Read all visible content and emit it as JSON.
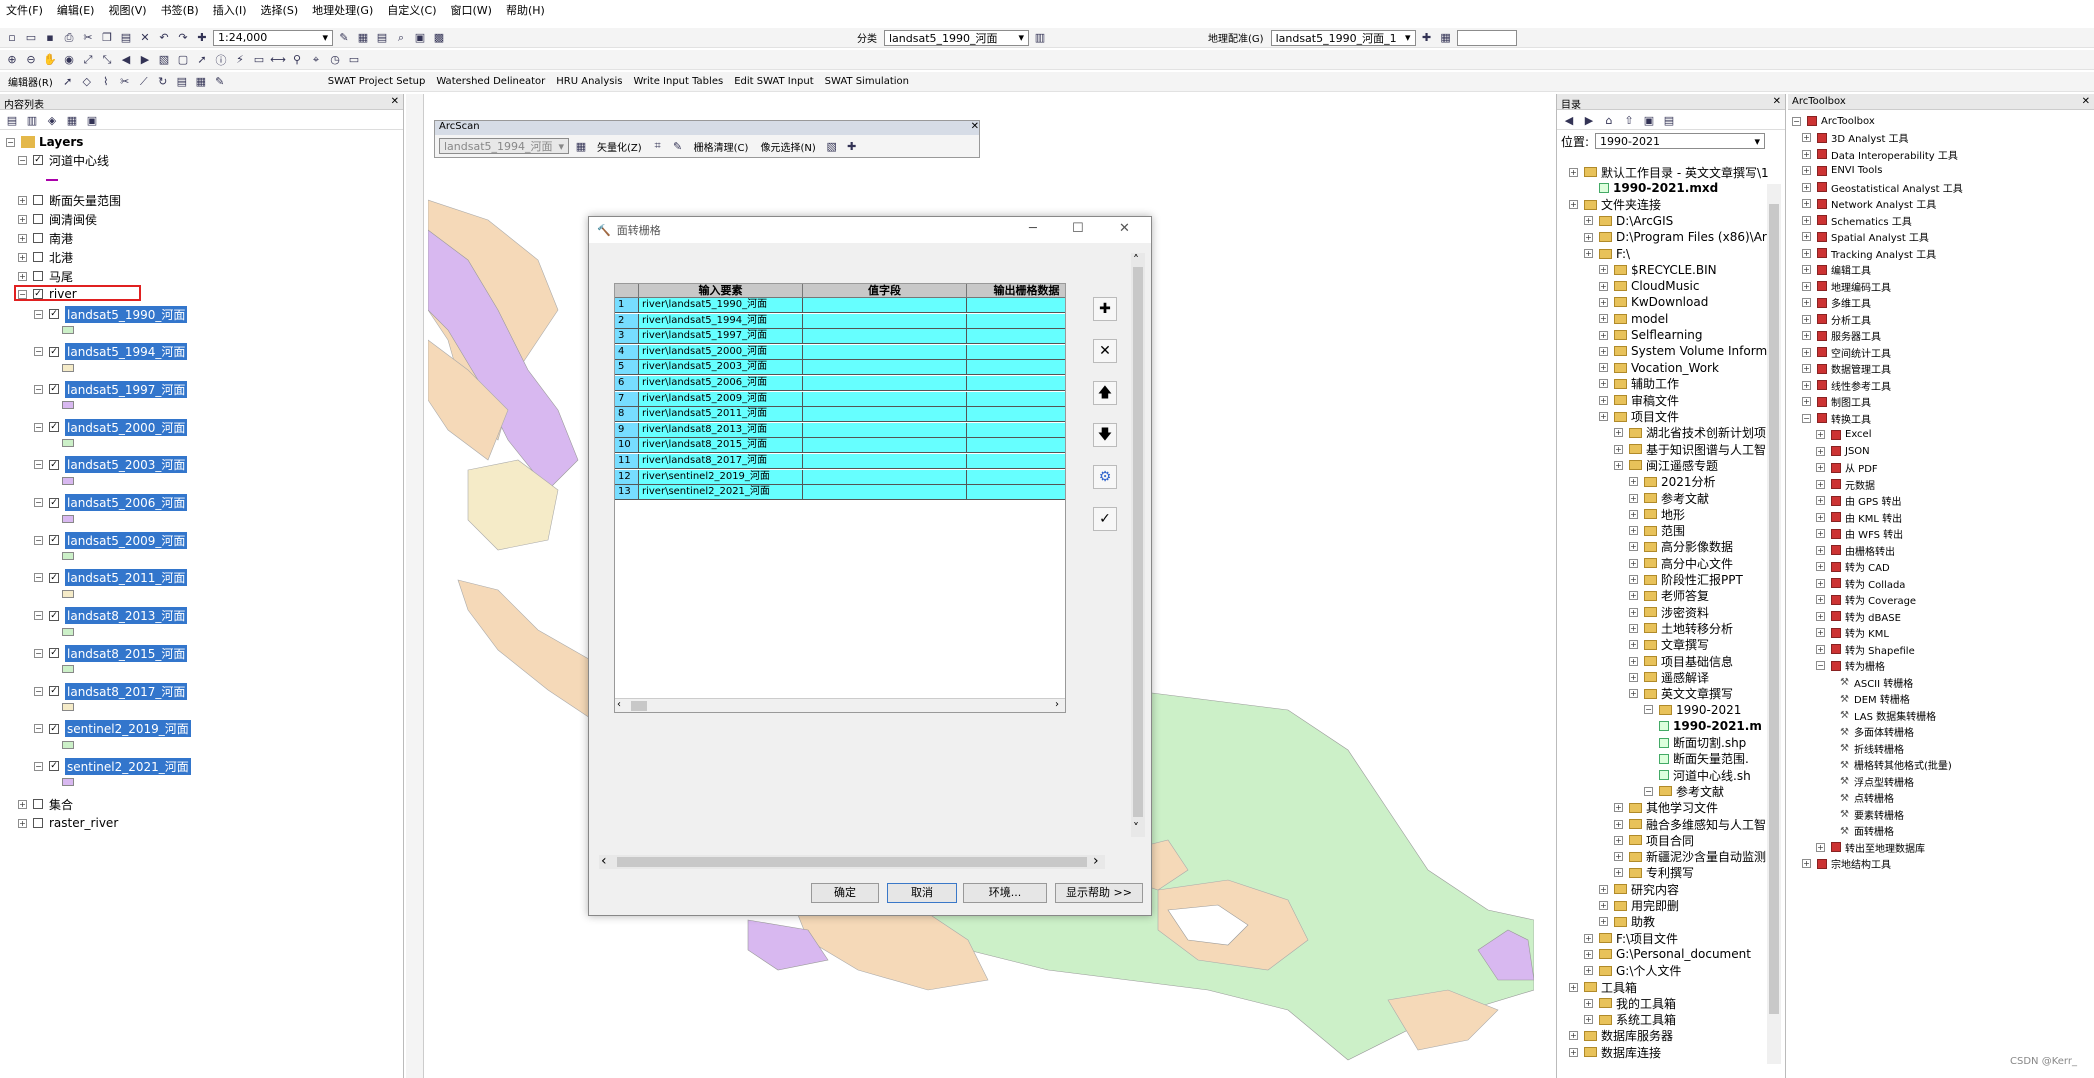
{
  "menu": [
    "文件(F)",
    "编辑(E)",
    "视图(V)",
    "书签(B)",
    "插入(I)",
    "选择(S)",
    "地理处理(G)",
    "自定义(C)",
    "窗口(W)",
    "帮助(H)"
  ],
  "toolbar": {
    "scale": "1:24,000",
    "classify_label": "分类",
    "classify_layer": "landsat5_1990_河面",
    "georef_label": "地理配准(G)",
    "georef_layer": "landsat5_1990_河面_1",
    "editor_label": "编辑器(R)",
    "swat_menus": [
      "SWAT Project Setup",
      "Watershed Delineator",
      "HRU Analysis",
      "Write Input Tables",
      "Edit SWAT Input",
      "SWAT Simulation"
    ]
  },
  "toc": {
    "title": "内容列表",
    "layers_root": "Layers",
    "items": [
      "河道中心线",
      "断面矢量范围",
      "闽清闽侯",
      "南港",
      "北港",
      "马尾",
      "river"
    ],
    "river_children": [
      "landsat5_1990_河面",
      "landsat5_1994_河面",
      "landsat5_1997_河面",
      "landsat5_2000_河面",
      "landsat5_2003_河面",
      "landsat5_2006_河面",
      "landsat5_2009_河面",
      "landsat5_2011_河面",
      "landsat8_2013_河面",
      "landsat8_2015_河面",
      "landsat8_2017_河面",
      "sentinel2_2019_河面",
      "sentinel2_2021_河面"
    ],
    "bottom_items": [
      "集合",
      "raster_river"
    ]
  },
  "arcscan": {
    "title": "ArcScan",
    "layer": "landsat5_1994_河面",
    "vectorize": "矢量化(Z)",
    "cleanup": "栅格清理(C)",
    "select": "像元选择(N)"
  },
  "dialog": {
    "title": "面转栅格",
    "columns": [
      "输入要素",
      "值字段",
      "输出栅格数据"
    ],
    "rows": [
      "river\\landsat5_1990_河面",
      "river\\landsat5_1994_河面",
      "river\\landsat5_1997_河面",
      "river\\landsat5_2000_河面",
      "river\\landsat5_2003_河面",
      "river\\landsat5_2006_河面",
      "river\\landsat5_2009_河面",
      "river\\landsat5_2011_河面",
      "river\\landsat8_2013_河面",
      "river\\landsat8_2015_河面",
      "river\\landsat8_2017_河面",
      "river\\sentinel2_2019_河面",
      "river\\sentinel2_2021_河面"
    ],
    "ok": "确定",
    "cancel": "取消",
    "env": "环境...",
    "help": "显示帮助 >>"
  },
  "catalog": {
    "title": "目录",
    "location_label": "位置:",
    "location_value": "1990-2021",
    "items": [
      "默认工作目录 - 英文文章撰写\\1",
      "1990-2021.mxd",
      "文件夹连接",
      "D:\\ArcGIS",
      "D:\\Program Files (x86)\\Arc",
      "F:\\",
      "$RECYCLE.BIN",
      "CloudMusic",
      "KwDownload",
      "model",
      "Selflearning",
      "System Volume Informa",
      "Vocation_Work",
      "辅助工作",
      "审稿文件",
      "项目文件",
      "湖北省技术创新计划项",
      "基于知识图谱与人工智",
      "闽江遥感专题",
      "2021分析",
      "参考文献",
      "地形",
      "范围",
      "高分影像数据",
      "高分中心文件",
      "阶段性汇报PPT",
      "老师答复",
      "涉密资料",
      "土地转移分析",
      "文章撰写",
      "项目基础信息",
      "遥感解译",
      "英文文章撰写",
      "1990-2021",
      "1990-2021.m",
      "断面切割.shp",
      "断面矢量范围.",
      "河道中心线.sh",
      "参考文献",
      "其他学习文件",
      "融合多维感知与人工智",
      "项目合同",
      "新疆泥沙含量自动监测",
      "专利撰写",
      "研究内容",
      "用完即删",
      "助教",
      "F:\\项目文件",
      "G:\\Personal_document",
      "G:\\个人文件",
      "工具箱",
      "我的工具箱",
      "系统工具箱",
      "数据库服务器",
      "数据库连接"
    ]
  },
  "arctoolbox": {
    "title": "ArcToolbox",
    "root": "ArcToolbox",
    "toolboxes": [
      "3D Analyst 工具",
      "Data Interoperability 工具",
      "ENVI Tools",
      "Geostatistical Analyst 工具",
      "Network Analyst 工具",
      "Schematics 工具",
      "Spatial Analyst 工具",
      "Tracking Analyst 工具",
      "编辑工具",
      "地理编码工具",
      "多维工具",
      "分析工具",
      "服务器工具",
      "空间统计工具",
      "数据管理工具",
      "线性参考工具",
      "制图工具",
      "转换工具"
    ],
    "conversion_children": [
      "Excel",
      "JSON",
      "从 PDF",
      "元数据",
      "由 GPS 转出",
      "由 KML 转出",
      "由 WFS 转出",
      "由栅格转出",
      "转为 CAD",
      "转为 Collada",
      "转为 Coverage",
      "转为 dBASE",
      "转为 KML",
      "转为 Shapefile",
      "转为栅格"
    ],
    "raster_tools": [
      "ASCII 转栅格",
      "DEM 转栅格",
      "LAS 数据集转栅格",
      "多面体转栅格",
      "折线转栅格",
      "栅格转其他格式(批量)",
      "浮点型转栅格",
      "点转栅格",
      "要素转栅格",
      "面转栅格"
    ],
    "after": [
      "转出至地理数据库",
      "宗地结构工具"
    ]
  },
  "watermark": "CSDN @Kerr_",
  "colors": {
    "selection": "#3376cc",
    "grid_cell": "#66ffff",
    "water_tan": "#f5d9b8",
    "water_green": "#ccf0c8",
    "water_purple": "#d8b8f0"
  }
}
